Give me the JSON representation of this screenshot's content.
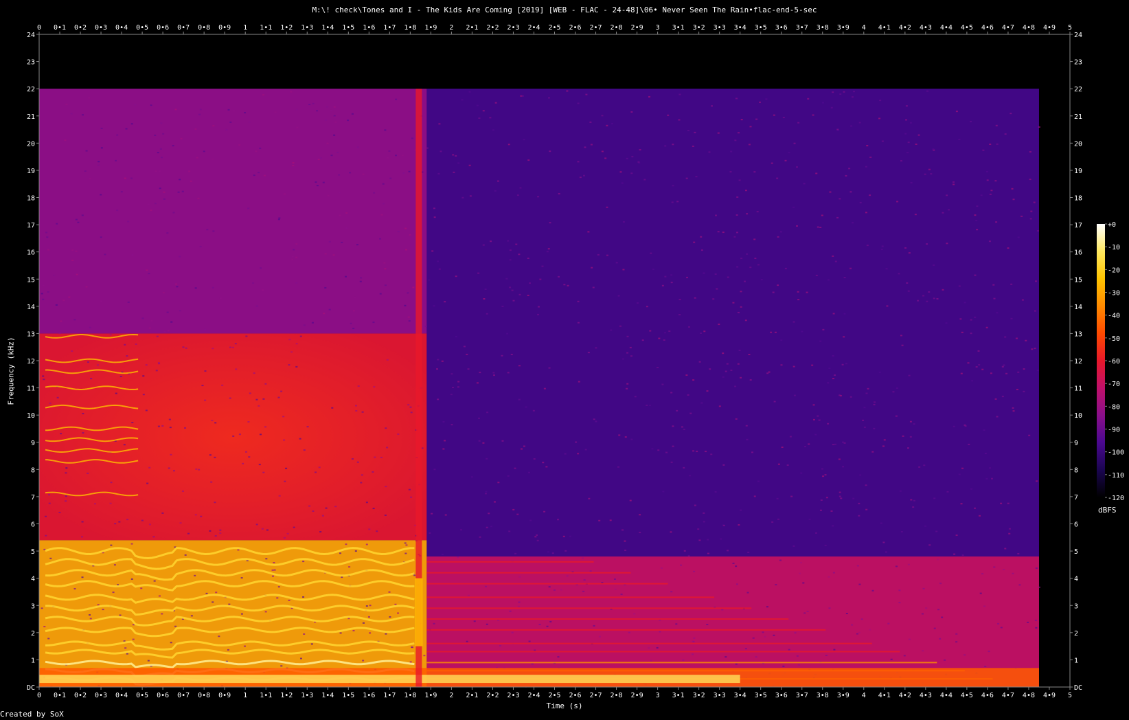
{
  "title": "M:\\! check\\Tones and I - The Kids Are Coming [2019] [WEB - FLAC - 24-48]\\06• Never Seen The Rain•flac-end-5-sec",
  "credit": "Created by SoX",
  "colorbar": {
    "unit": "dBFS",
    "ticks": [
      "+0",
      "-10",
      "-20",
      "-30",
      "-40",
      "-50",
      "-60",
      "-70",
      "-80",
      "-90",
      "-100",
      "-110",
      "-120"
    ],
    "colors": [
      "#000000",
      "#1a0550",
      "#4a0890",
      "#8a0f8a",
      "#c0106a",
      "#e8182a",
      "#ff4a00",
      "#ff8a00",
      "#ffc400",
      "#ffe860",
      "#ffffff"
    ]
  },
  "chart_data": {
    "type": "heatmap",
    "title": "M:\\! check\\Tones and I - The Kids Are Coming [2019] [WEB - FLAC - 24-48]\\06• Never Seen The Rain•flac-end-5-sec",
    "xlabel": "Time (s)",
    "ylabel": "Frequency (kHz)",
    "xlim": [
      0,
      5
    ],
    "ylim": [
      0,
      24
    ],
    "x_ticks": [
      "0",
      "0•1",
      "0•2",
      "0•3",
      "0•4",
      "0•5",
      "0•6",
      "0•7",
      "0•8",
      "0•9",
      "1",
      "1•1",
      "1•2",
      "1•3",
      "1•4",
      "1•5",
      "1•6",
      "1•7",
      "1•8",
      "1•9",
      "2",
      "2•1",
      "2•2",
      "2•3",
      "2•4",
      "2•5",
      "2•6",
      "2•7",
      "2•8",
      "2•9",
      "3",
      "3•1",
      "3•2",
      "3•3",
      "3•4",
      "3•5",
      "3•6",
      "3•7",
      "3•8",
      "3•9",
      "4",
      "4•1",
      "4•2",
      "4•3",
      "4•4",
      "4•5",
      "4•6",
      "4•7",
      "4•8",
      "4•9",
      "5"
    ],
    "y_ticks": [
      "DC",
      "1",
      "2",
      "3",
      "4",
      "5",
      "6",
      "7",
      "8",
      "9",
      "10",
      "11",
      "12",
      "13",
      "14",
      "15",
      "16",
      "17",
      "18",
      "19",
      "20",
      "21",
      "22",
      "23",
      "24"
    ],
    "color_range_dbfs": [
      -120,
      0
    ],
    "noise_floor_dbfs": -100,
    "upper_cutoff_khz": 22,
    "regions": [
      {
        "t_start": 0,
        "t_end": 1.88,
        "f_low": 0,
        "f_high": 5.4,
        "level_dbfs": -30
      },
      {
        "t_start": 0,
        "t_end": 1.88,
        "f_low": 5.4,
        "f_high": 13,
        "level_dbfs": -60
      },
      {
        "t_start": 0,
        "t_end": 1.88,
        "f_low": 13,
        "f_high": 22,
        "level_dbfs": -82
      },
      {
        "t_start": 1.88,
        "t_end": 4.85,
        "f_low": 0,
        "f_high": 4.8,
        "level_dbfs": -70
      },
      {
        "t_start": 1.88,
        "t_end": 4.85,
        "f_low": 4.8,
        "f_high": 22,
        "level_dbfs": -98
      }
    ],
    "harmonic_lines_khz": [
      0.3,
      0.6,
      0.9,
      1.3,
      1.6,
      2.1,
      2.5,
      2.9,
      3.3,
      3.8,
      4.2,
      4.6,
      5.0
    ],
    "transient_at_s": 1.84
  }
}
